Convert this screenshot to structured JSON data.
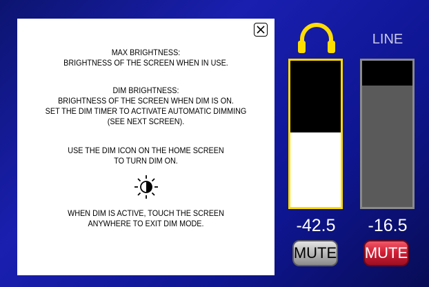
{
  "help": {
    "lines": [
      "MAX BRIGHTNESS:",
      "BRIGHTNESS OF THE SCREEN WHEN IN USE.",
      "DIM BRIGHTNESS:",
      "BRIGHTNESS OF THE SCREEN WHEN DIM IS ON.",
      "SET THE DIM TIMER TO ACTIVATE AUTOMATIC DIMMING",
      "(SEE NEXT SCREEN).",
      "USE THE DIM ICON ON THE HOME SCREEN",
      "TO TURN DIM ON.",
      "WHEN DIM IS ACTIVE, TOUCH THE SCREEN",
      "ANYWHERE TO EXIT DIM MODE."
    ],
    "icons": {
      "close": "close-icon",
      "dim": "dim-icon"
    }
  },
  "headphone": {
    "icon": "headphones-icon",
    "level_fraction": 0.51,
    "readout": "-42.5",
    "mute_label": "MUTE",
    "frame_color": "#ffdd00",
    "fill_color": "#ffffff"
  },
  "line": {
    "label": "LINE",
    "level_fraction": 0.83,
    "readout": "-16.5",
    "mute_label": "MUTE",
    "frame_color": "#8a8a8a",
    "fill_color": "#5a5a5a"
  }
}
